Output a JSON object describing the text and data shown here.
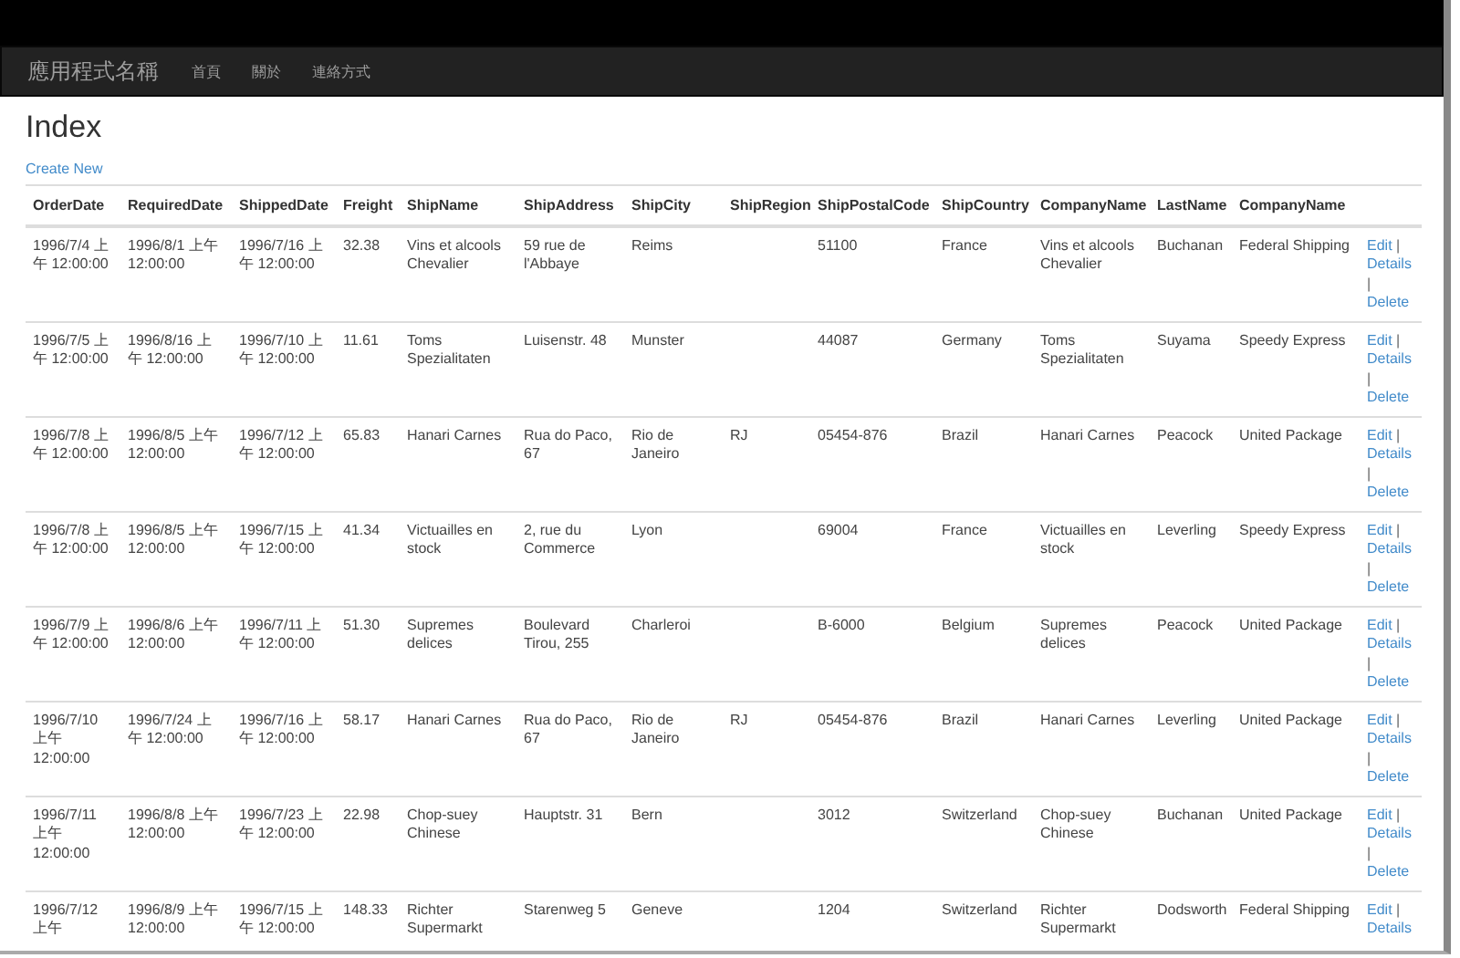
{
  "navbar": {
    "brand": "應用程式名稱",
    "links": [
      "首頁",
      "關於",
      "連絡方式"
    ]
  },
  "page": {
    "title": "Index",
    "create_link": "Create New"
  },
  "table": {
    "columns": [
      "OrderDate",
      "RequiredDate",
      "ShippedDate",
      "Freight",
      "ShipName",
      "ShipAddress",
      "ShipCity",
      "ShipRegion",
      "ShipPostalCode",
      "ShipCountry",
      "CompanyName",
      "LastName",
      "CompanyName"
    ],
    "rows": [
      {
        "order_date": "1996/7/4 上午 12:00:00",
        "required_date": "1996/8/1 上午 12:00:00",
        "shipped_date": "1996/7/16 上午 12:00:00",
        "freight": "32.38",
        "ship_name": "Vins et alcools Chevalier",
        "ship_address": "59 rue de l'Abbaye",
        "ship_city": "Reims",
        "ship_postal_code": "51100",
        "ship_country": "France",
        "company_name": "Vins et alcools Chevalier",
        "last_name": "Buchanan",
        "shipper_name": "Federal Shipping",
        "actions": [
          {
            "kind": "link",
            "text": "Edit"
          },
          {
            "kind": "sep",
            "text": "|"
          },
          {
            "kind": "link",
            "text": "Details"
          },
          {
            "kind": "sep",
            "text": "|"
          },
          {
            "kind": "link",
            "text": "Delete"
          }
        ]
      },
      {
        "order_date": "1996/7/5 上午 12:00:00",
        "required_date": "1996/8/16 上午 12:00:00",
        "shipped_date": "1996/7/10 上午 12:00:00",
        "freight": "11.61",
        "ship_name": "Toms Spezialitaten",
        "ship_address": "Luisenstr. 48",
        "ship_city": "Munster",
        "ship_postal_code": "44087",
        "ship_country": "Germany",
        "company_name": "Toms Spezialitaten",
        "last_name": "Suyama",
        "shipper_name": "Speedy Express",
        "actions": [
          {
            "kind": "link",
            "text": "Edit"
          },
          {
            "kind": "sep",
            "text": "|"
          },
          {
            "kind": "link",
            "text": "Details"
          },
          {
            "kind": "sep",
            "text": "|"
          },
          {
            "kind": "link",
            "text": "Delete"
          }
        ]
      },
      {
        "order_date": "1996/7/8 上午 12:00:00",
        "required_date": "1996/8/5 上午 12:00:00",
        "shipped_date": "1996/7/12 上午 12:00:00",
        "freight": "65.83",
        "ship_name": "Hanari Carnes",
        "ship_address": "Rua do Paco, 67",
        "ship_city": "Rio de Janeiro",
        "ship_region": "RJ",
        "ship_postal_code": "05454-876",
        "ship_country": "Brazil",
        "company_name": "Hanari Carnes",
        "last_name": "Peacock",
        "shipper_name": "United Package",
        "actions": [
          {
            "kind": "link",
            "text": "Edit"
          },
          {
            "kind": "sep",
            "text": "|"
          },
          {
            "kind": "link",
            "text": "Details"
          },
          {
            "kind": "sep",
            "text": "|"
          },
          {
            "kind": "link",
            "text": "Delete"
          }
        ]
      },
      {
        "order_date": "1996/7/8 上午 12:00:00",
        "required_date": "1996/8/5 上午 12:00:00",
        "shipped_date": "1996/7/15 上午 12:00:00",
        "freight": "41.34",
        "ship_name": "Victuailles en stock",
        "ship_address": "2, rue du Commerce",
        "ship_city": "Lyon",
        "ship_postal_code": "69004",
        "ship_country": "France",
        "company_name": "Victuailles en stock",
        "last_name": "Leverling",
        "shipper_name": "Speedy Express",
        "actions": [
          {
            "kind": "link",
            "text": "Edit"
          },
          {
            "kind": "sep",
            "text": "|"
          },
          {
            "kind": "link",
            "text": "Details"
          },
          {
            "kind": "sep",
            "text": "|"
          },
          {
            "kind": "link",
            "text": "Delete"
          }
        ]
      },
      {
        "order_date": "1996/7/9 上午 12:00:00",
        "required_date": "1996/8/6 上午 12:00:00",
        "shipped_date": "1996/7/11 上午 12:00:00",
        "freight": "51.30",
        "ship_name": "Supremes delices",
        "ship_address": "Boulevard Tirou, 255",
        "ship_city": "Charleroi",
        "ship_postal_code": "B-6000",
        "ship_country": "Belgium",
        "company_name": "Supremes delices",
        "last_name": "Peacock",
        "shipper_name": "United Package",
        "actions": [
          {
            "kind": "link",
            "text": "Edit"
          },
          {
            "kind": "sep",
            "text": "|"
          },
          {
            "kind": "link",
            "text": "Details"
          },
          {
            "kind": "sep",
            "text": "|"
          },
          {
            "kind": "link",
            "text": "Delete"
          }
        ]
      },
      {
        "order_date": "1996/7/10 上午 12:00:00",
        "required_date": "1996/7/24 上午 12:00:00",
        "shipped_date": "1996/7/16 上午 12:00:00",
        "freight": "58.17",
        "ship_name": "Hanari Carnes",
        "ship_address": "Rua do Paco, 67",
        "ship_city": "Rio de Janeiro",
        "ship_region": "RJ",
        "ship_postal_code": "05454-876",
        "ship_country": "Brazil",
        "company_name": "Hanari Carnes",
        "last_name": "Leverling",
        "shipper_name": "United Package",
        "actions": [
          {
            "kind": "link",
            "text": "Edit"
          },
          {
            "kind": "sep",
            "text": "|"
          },
          {
            "kind": "link",
            "text": "Details"
          },
          {
            "kind": "sep",
            "text": "|"
          },
          {
            "kind": "link",
            "text": "Delete"
          }
        ]
      },
      {
        "order_date": "1996/7/11 上午 12:00:00",
        "required_date": "1996/8/8 上午 12:00:00",
        "shipped_date": "1996/7/23 上午 12:00:00",
        "freight": "22.98",
        "ship_name": "Chop-suey Chinese",
        "ship_address": "Hauptstr. 31",
        "ship_city": "Bern",
        "ship_postal_code": "3012",
        "ship_country": "Switzerland",
        "company_name": "Chop-suey Chinese",
        "last_name": "Buchanan",
        "shipper_name": "United Package",
        "actions": [
          {
            "kind": "link",
            "text": "Edit"
          },
          {
            "kind": "sep",
            "text": "|"
          },
          {
            "kind": "link",
            "text": "Details"
          },
          {
            "kind": "sep",
            "text": "|"
          },
          {
            "kind": "link",
            "text": "Delete"
          }
        ]
      },
      {
        "order_date": "1996/7/12 上午",
        "required_date": "1996/8/9 上午 12:00:00",
        "shipped_date": "1996/7/15 上午 12:00:00",
        "freight": "148.33",
        "ship_name": "Richter Supermarkt",
        "ship_address": "Starenweg 5",
        "ship_city": "Geneve",
        "ship_postal_code": "1204",
        "ship_country": "Switzerland",
        "company_name": "Richter Supermarkt",
        "last_name": "Dodsworth",
        "shipper_name": "Federal Shipping",
        "actions": [
          {
            "kind": "link",
            "text": "Edit"
          },
          {
            "kind": "sep",
            "text": "|"
          },
          {
            "kind": "link",
            "text": "Details"
          }
        ]
      }
    ]
  }
}
